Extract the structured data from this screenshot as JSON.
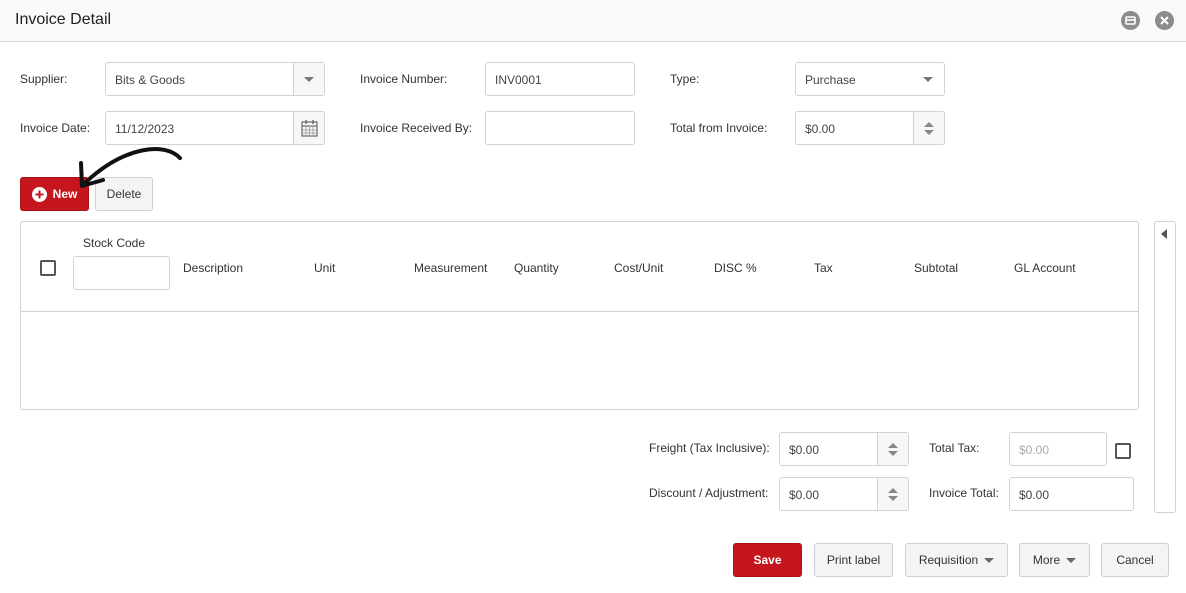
{
  "window": {
    "title": "Invoice Detail"
  },
  "form": {
    "supplier_label": "Supplier:",
    "supplier_value": "Bits & Goods",
    "invoice_number_label": "Invoice Number:",
    "invoice_number_value": "INV0001",
    "type_label": "Type:",
    "type_value": "Purchase",
    "invoice_date_label": "Invoice Date:",
    "invoice_date_value": "11/12/2023",
    "received_by_label": "Invoice Received By:",
    "received_by_value": "",
    "total_from_invoice_label": "Total from Invoice:",
    "total_from_invoice_value": "$0.00"
  },
  "toolbar": {
    "new_label": "New",
    "delete_label": "Delete"
  },
  "grid": {
    "stock_code_label": "Stock Code",
    "columns": [
      "Description",
      "Unit",
      "Measurement",
      "Quantity",
      "Cost/Unit",
      "DISC %",
      "Tax",
      "Subtotal",
      "GL Account"
    ]
  },
  "totals": {
    "freight_label": "Freight (Tax Inclusive):",
    "freight_value": "$0.00",
    "total_tax_label": "Total Tax:",
    "total_tax_value": "$0.00",
    "discount_label": "Discount / Adjustment:",
    "discount_value": "$0.00",
    "invoice_total_label": "Invoice Total:",
    "invoice_total_value": "$0.00"
  },
  "footer": {
    "save_label": "Save",
    "print_label": "Print label",
    "requisition_label": "Requisition",
    "more_label": "More",
    "cancel_label": "Cancel"
  },
  "colors": {
    "accent": "#c4161c",
    "border": "#d2d2d2",
    "header_bg": "#fafafa"
  },
  "icons": [
    "minimize-icon",
    "close-icon",
    "chevron-down-icon",
    "calendar-icon",
    "spinner-icon",
    "plus-circle-icon",
    "collapse-left-icon",
    "annotation-arrow"
  ]
}
